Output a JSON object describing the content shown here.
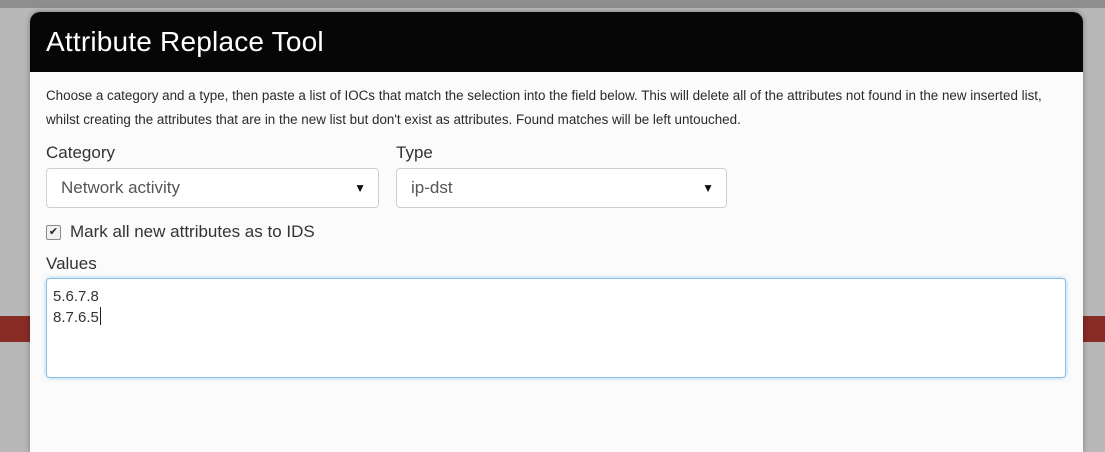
{
  "modal": {
    "title": "Attribute Replace Tool",
    "intro_text": "Choose a category and a type, then paste a list of IOCs that match the selection into the field below. This will delete all of the attributes not found in the new inserted list, whilst creating the attributes that are in the new list but don't exist as attributes. Found matches will be left untouched."
  },
  "form": {
    "category": {
      "label": "Category",
      "value": "Network activity"
    },
    "type": {
      "label": "Type",
      "value": "ip-dst"
    },
    "to_ids": {
      "label": "Mark all new attributes as to IDS",
      "checked": true,
      "glyph": "✔"
    },
    "values": {
      "label": "Values",
      "lines": [
        "5.6.7.8",
        "8.7.6.5"
      ]
    }
  },
  "icons": {
    "select_caret": "▼"
  }
}
